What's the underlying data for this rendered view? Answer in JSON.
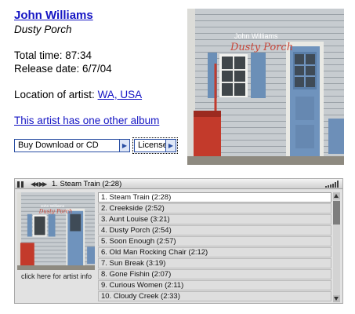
{
  "artist": {
    "name": "John Williams",
    "album": "Dusty Porch",
    "total_time_label": "Total time: 87:34",
    "release_date_label": "Release date: 6/7/04",
    "location_label": "Location of artist:",
    "location_link": "WA, USA",
    "other_album_link": "This artist has one other album"
  },
  "buttons": {
    "download": "Buy Download or CD",
    "license": "License"
  },
  "cover": {
    "artist_text": "John Williams",
    "album_text": "Dusty Porch"
  },
  "player": {
    "now_playing": "1. Steam Train (2:28)",
    "art_caption": "click here for artist info",
    "tracks": [
      "1. Steam Train (2:28)",
      "2. Creekside (2:52)",
      "3. Aunt Louise (3:21)",
      "4. Dusty Porch (2:54)",
      "5. Soon Enough (2:57)",
      "6. Old Man Rocking Chair (2:12)",
      "7. Sun Break (3:19)",
      "8. Gone Fishin (2:07)",
      "9. Curious Women (2:11)",
      "10. Cloudy Creek (2:33)"
    ]
  },
  "colors": {
    "link": "#1515c4",
    "button_border": "#2a4fa3",
    "player_bg": "#e2e2e2"
  }
}
